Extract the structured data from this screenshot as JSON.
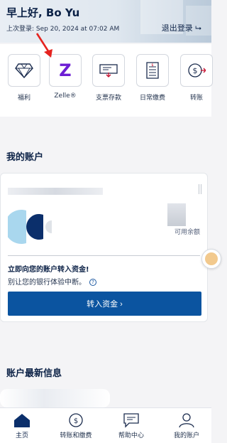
{
  "header": {
    "greeting": "早上好, Bo Yu",
    "last_login": "上次登录: Sep 20, 2024 at 07:02 AM",
    "logout_label": "退出登录 ⮡"
  },
  "quick_actions": [
    {
      "label": "福利",
      "icon": "diamond-icon"
    },
    {
      "label": "Zelle®",
      "icon": "zelle-icon",
      "glyph": "Z"
    },
    {
      "label": "支票存款",
      "icon": "check-deposit-icon"
    },
    {
      "label": "日常缴费",
      "icon": "bill-pay-icon"
    },
    {
      "label": "转账",
      "icon": "transfer-icon"
    }
  ],
  "accounts": {
    "title": "我的账户",
    "available_label": "可用余额",
    "promo_title": "立即向您的账户转入资金!",
    "promo_text": "别让您的银行体验中断。",
    "transfer_button": "转入资金 ›"
  },
  "news": {
    "title": "账户最新信息"
  },
  "tabs": [
    {
      "label": "主页",
      "icon": "home-icon",
      "active": true
    },
    {
      "label": "转账和缴费",
      "icon": "transfer-pay-icon"
    },
    {
      "label": "帮助中心",
      "icon": "help-chat-icon"
    },
    {
      "label": "我的账户",
      "icon": "user-icon"
    }
  ],
  "colors": {
    "primary": "#0b54a0",
    "navy": "#0b2146",
    "zelle": "#6d1ed4",
    "annotation_arrow": "#e5231f"
  }
}
